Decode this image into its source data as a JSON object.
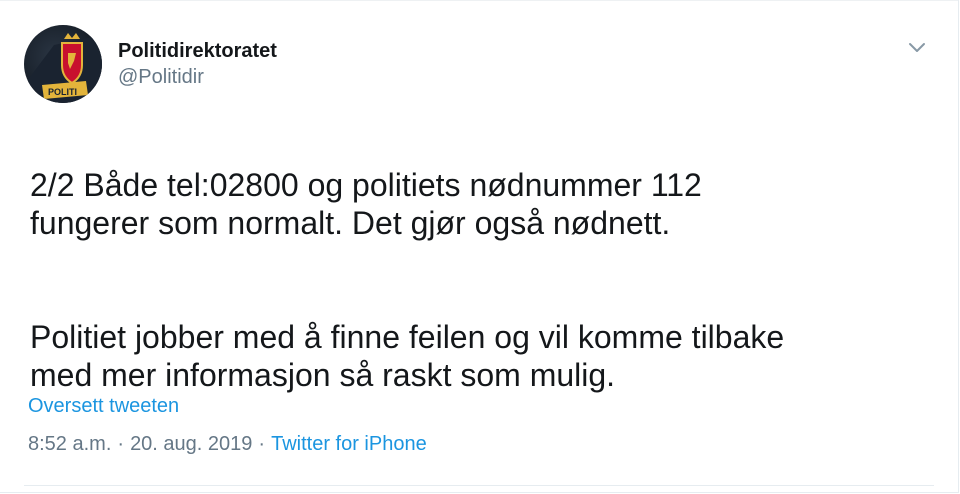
{
  "author": {
    "display_name": "Politidirektoratet",
    "handle": "@Politidir",
    "avatar_badge_text": "POLITI"
  },
  "menu": {
    "icon": "chevron-down-icon"
  },
  "tweet": {
    "paragraphs": [
      "2/2 Både tel:02800 og politiets nødnummer 112\nfungerer som normalt. Det gjør også nødnett.",
      "Politiet jobber med å finne feilen og vil komme tilbake\nmed mer informasjon så raskt som mulig."
    ]
  },
  "translate_label": "Oversett tweeten",
  "meta": {
    "time": "8:52 a.m.",
    "separator": "·",
    "date": "20. aug. 2019",
    "source": "Twitter for iPhone"
  },
  "colors": {
    "text": "#14171a",
    "secondary": "#657786",
    "link": "#1b95e0",
    "border": "#e6ecf0"
  }
}
